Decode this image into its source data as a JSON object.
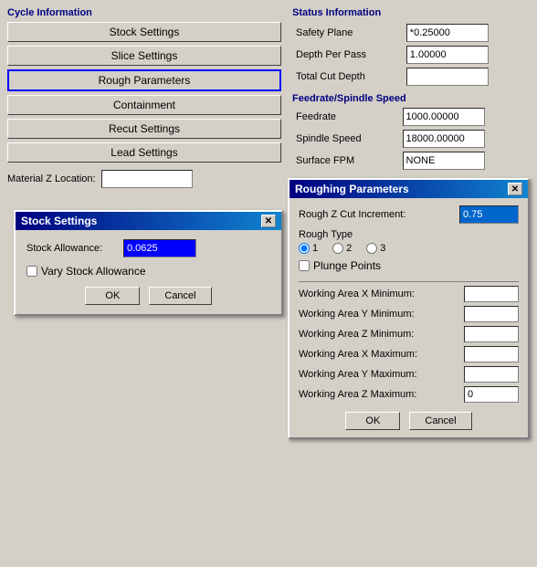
{
  "leftPanel": {
    "cycleInfo": {
      "title": "Cycle Information",
      "buttons": [
        {
          "label": "Stock Settings",
          "selected": false,
          "id": "stock-settings"
        },
        {
          "label": "Slice Settings",
          "selected": false,
          "id": "slice-settings"
        },
        {
          "label": "Rough Parameters",
          "selected": true,
          "id": "rough-parameters"
        },
        {
          "label": "Containment",
          "selected": false,
          "id": "containment"
        },
        {
          "label": "Recut Settings",
          "selected": false,
          "id": "recut-settings"
        },
        {
          "label": "Lead Settings",
          "selected": false,
          "id": "lead-settings"
        }
      ]
    },
    "materialZ": {
      "label": "Material Z Location:",
      "value": ""
    }
  },
  "rightPanel": {
    "statusInfo": {
      "title": "Status Information",
      "safetyPlane": {
        "label": "Safety Plane",
        "value": "*0.25000"
      },
      "depthPerPass": {
        "label": "Depth Per Pass",
        "value": "1.00000"
      },
      "totalCutDepth": {
        "label": "Total Cut Depth",
        "value": ""
      }
    },
    "feedrateSpindle": {
      "title": "Feedrate/Spindle Speed",
      "feedrate": {
        "label": "Feedrate",
        "value": "1000.00000"
      },
      "spindleSpeed": {
        "label": "Spindle Speed",
        "value": "18000.00000"
      },
      "surfaceFPM": {
        "label": "Surface FPM",
        "value": "NONE"
      }
    }
  },
  "stockSettingsModal": {
    "title": "Stock Settings",
    "stockAllowance": {
      "label": "Stock Allowance:",
      "value": "0.0625"
    },
    "varyStockAllowance": {
      "label": "Vary Stock Allowance",
      "checked": false
    },
    "okButton": "OK",
    "cancelButton": "Cancel"
  },
  "roughingParametersModal": {
    "title": "Roughing Parameters",
    "roughZCutIncrement": {
      "label": "Rough Z Cut Increment:",
      "value": "0.75"
    },
    "roughType": {
      "label": "Rough Type",
      "options": [
        "1",
        "2",
        "3"
      ],
      "selected": "1"
    },
    "plungePoints": {
      "label": "Plunge Points",
      "checked": false
    },
    "workingArea": {
      "xMin": {
        "label": "Working Area X Minimum:",
        "value": ""
      },
      "yMin": {
        "label": "Working Area Y Minimum:",
        "value": ""
      },
      "zMin": {
        "label": "Working Area Z Minimum:",
        "value": ""
      },
      "xMax": {
        "label": "Working Area X Maximum:",
        "value": ""
      },
      "yMax": {
        "label": "Working Area Y Maximum:",
        "value": ""
      },
      "zMax": {
        "label": "Working Area Z Maximum:",
        "value": "0"
      }
    },
    "okButton": "OK",
    "cancelButton": "Cancel"
  },
  "icons": {
    "close": "✕"
  }
}
